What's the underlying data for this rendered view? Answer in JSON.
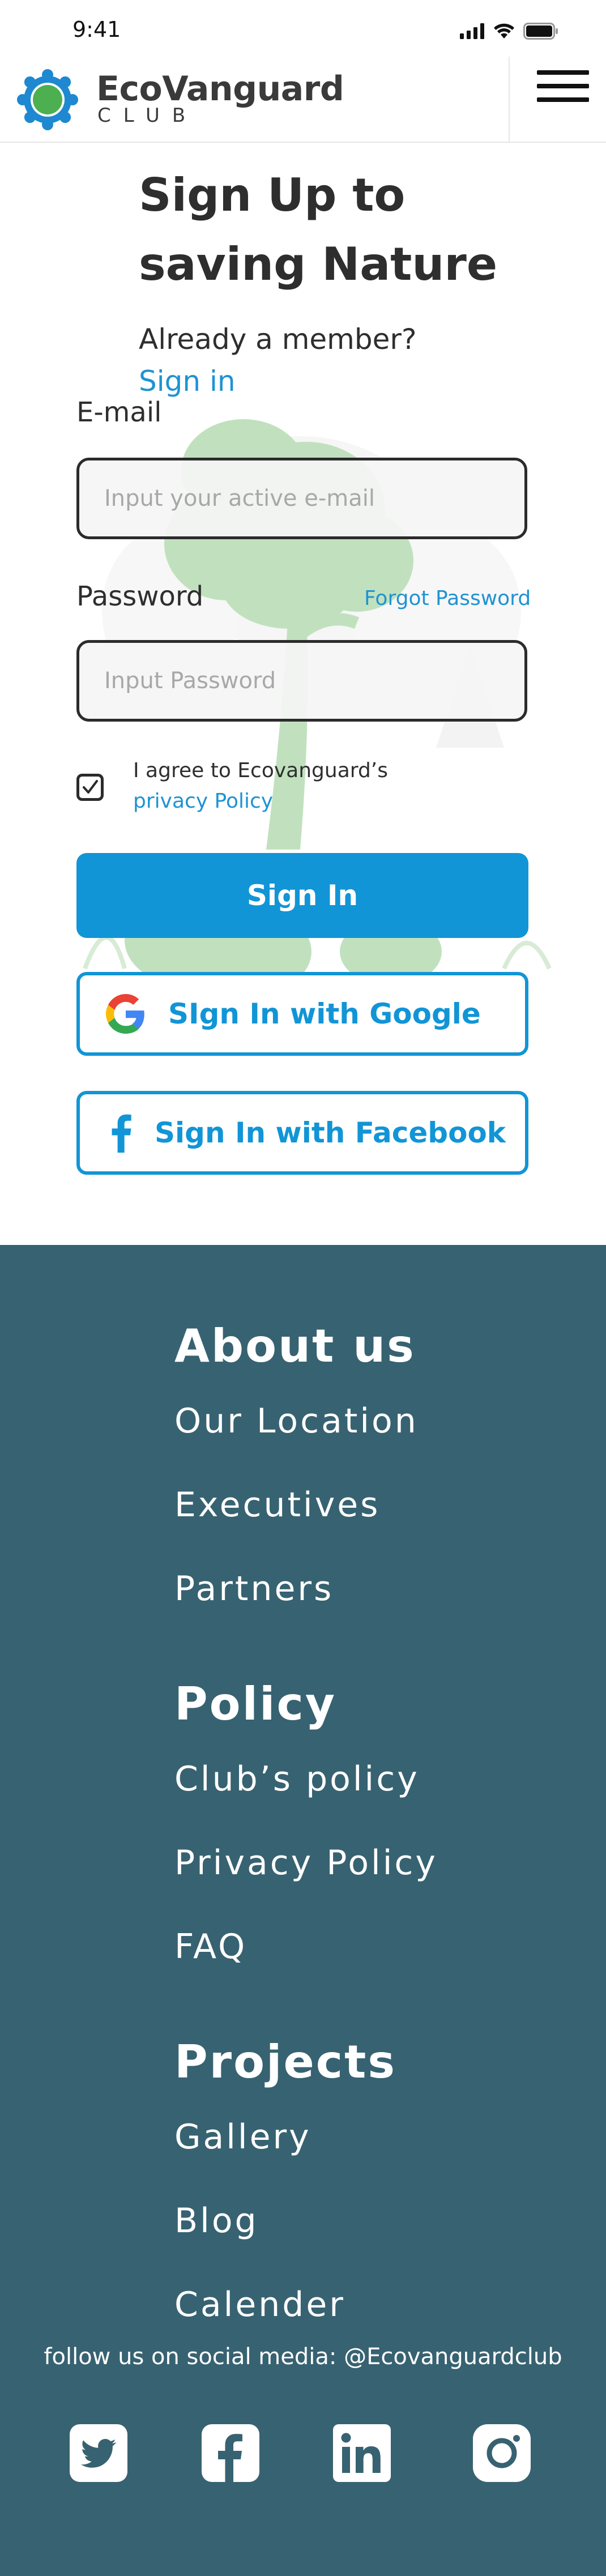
{
  "status_bar": {
    "time": "9:41"
  },
  "header": {
    "brand_name": "EcoVanguard",
    "brand_sub": "CLUB",
    "menu_icon": "hamburger-menu-icon"
  },
  "hero": {
    "title_line1": "Sign Up to",
    "title_line2": "saving Nature",
    "member_text": "Already a member?",
    "signin_link": "Sign in"
  },
  "form": {
    "email_label": "E-mail",
    "email_placeholder": "Input your active e-mail",
    "email_value": "",
    "password_label": "Password",
    "forgot_password": "Forgot Password",
    "password_placeholder": "Input Password",
    "password_value": "",
    "agree_text": "I agree to Ecovanguard’s",
    "privacy_link": "privacy Policy",
    "checkbox_checked": true,
    "signin_button": "Sign In",
    "google_button": "SIgn In with Google",
    "facebook_button": "Sign In with Facebook"
  },
  "footer": {
    "about": {
      "heading": "About us",
      "links": [
        "Our Location",
        "Executives",
        "Partners"
      ]
    },
    "policy": {
      "heading": "Policy",
      "links": [
        "Club’s policy",
        "Privacy Policy",
        "FAQ"
      ]
    },
    "projects": {
      "heading": "Projects",
      "links": [
        "Gallery",
        "Blog",
        "Calender"
      ]
    },
    "social_text": "follow us on social media: @Ecovanguardclub",
    "social_icons": [
      "twitter-icon",
      "facebook-icon",
      "linkedin-icon",
      "instagram-icon"
    ]
  },
  "colors": {
    "accent": "#1195d6",
    "footer_bg": "#376271",
    "logo_blue": "#1e88d0",
    "logo_green": "#4caf50"
  }
}
